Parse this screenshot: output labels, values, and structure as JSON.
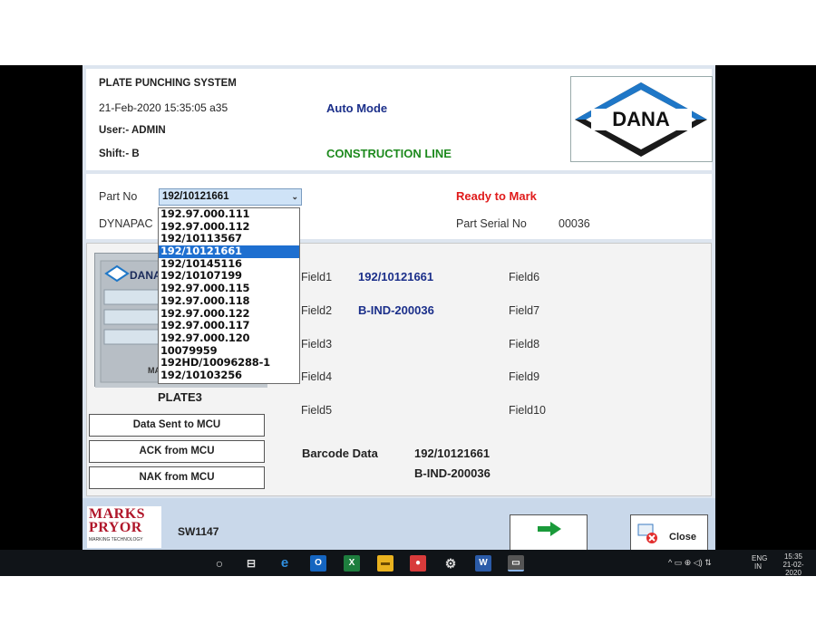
{
  "header": {
    "system_title": "PLATE PUNCHING SYSTEM",
    "datetime": "21-Feb-2020 15:35:05 a35",
    "user": "User:- ADMIN",
    "shift": "Shift:- B",
    "mode": "Auto Mode",
    "line": "CONSTRUCTION LINE",
    "logo_text": "DANA"
  },
  "part": {
    "label": "Part No",
    "selected": "192/10121661",
    "customer": "DYNAPAC",
    "status": "Ready to Mark",
    "serial_label": "Part Serial No",
    "serial_value": "00036",
    "options": [
      "192.97.000.111",
      "192.97.000.112",
      "192/10113567",
      "192/10121661",
      "192/10145116",
      "192/10107199",
      "192.97.000.115",
      "192.97.000.118",
      "192.97.000.122",
      "192.97.000.117",
      "192.97.000.120",
      "10079959",
      "192HD/10096288-1",
      "192/10103256"
    ]
  },
  "plate": {
    "name": "PLATE3",
    "image_text": "DANA",
    "image_text2": "MA"
  },
  "fields": {
    "field1_label": "Field1",
    "field1_value": "192/10121661",
    "field2_label": "Field2",
    "field2_value": "B-IND-200036",
    "field3_label": "Field3",
    "field4_label": "Field4",
    "field5_label": "Field5",
    "field6_label": "Field6",
    "field7_label": "Field7",
    "field8_label": "Field8",
    "field9_label": "Field9",
    "field10_label": "Field10"
  },
  "barcode": {
    "label": "Barcode Data",
    "line1": "192/10121661",
    "line2": "B-IND-200036"
  },
  "status_buttons": {
    "data_sent": "Data Sent to MCU",
    "ack": "ACK from MCU",
    "nak": "NAK from MCU"
  },
  "footer": {
    "brand_line1": "MARKS",
    "brand_line2": "PRYOR",
    "brand_tagline": "MARKING TECHNOLOGY",
    "software": "SW1147",
    "close_label": "Close"
  },
  "taskbar": {
    "lang1": "ENG",
    "lang2": "IN",
    "time": "15:35",
    "date": "21-02-2020"
  },
  "colors": {
    "mode": "#1b2f8a",
    "line": "#1e8a1e",
    "status": "#e01b1b",
    "field_value": "#1b2f8a",
    "selection": "#1e6fd0"
  }
}
